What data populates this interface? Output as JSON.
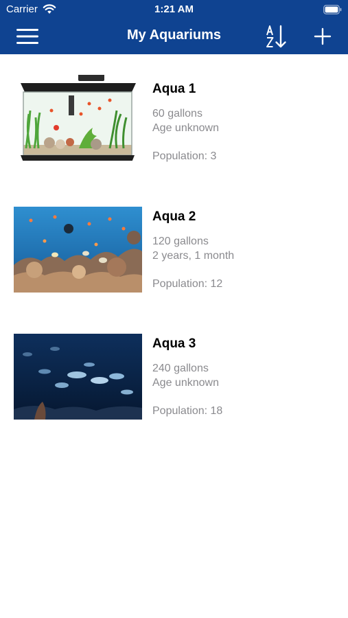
{
  "status_bar": {
    "carrier": "Carrier",
    "time": "1:21 AM"
  },
  "nav": {
    "title": "My Aquariums",
    "menu_icon": "hamburger-menu-icon",
    "sort_icon": "sort-a-z-icon",
    "add_icon": "plus-icon"
  },
  "colors": {
    "nav_background": "#0f4391",
    "secondary_text": "#8a8a8e"
  },
  "aquariums": [
    {
      "name": "Aqua 1",
      "volume": "60 gallons",
      "age": "Age unknown",
      "population": "Population: 3",
      "image": "aquarium-tank-photo"
    },
    {
      "name": "Aqua 2",
      "volume": "120 gallons",
      "age": "2 years, 1 month",
      "population": "Population: 12",
      "image": "coral-reef-photo"
    },
    {
      "name": "Aqua 3",
      "volume": "240 gallons",
      "age": "Age unknown",
      "population": "Population: 18",
      "image": "deep-sea-fish-photo"
    }
  ]
}
